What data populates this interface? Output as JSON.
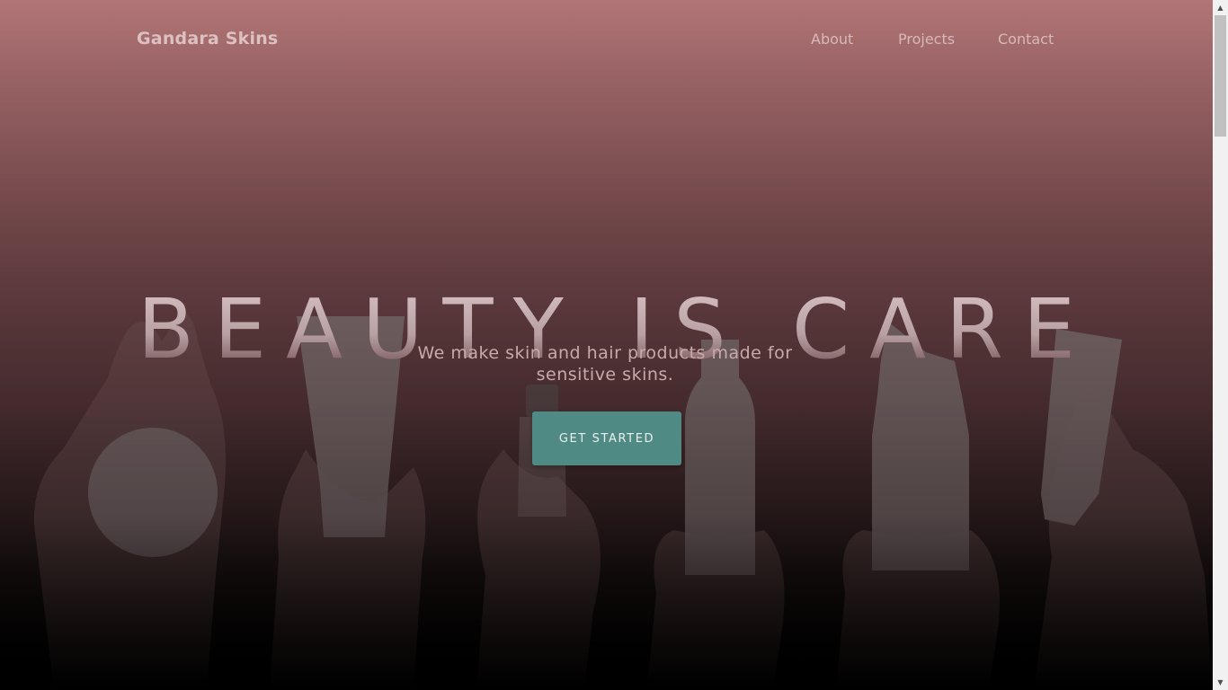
{
  "brand": {
    "name": "Gandara Skins"
  },
  "nav": {
    "items": [
      {
        "label": "About"
      },
      {
        "label": "Projects"
      },
      {
        "label": "Contact"
      }
    ]
  },
  "hero": {
    "headline": "BEAUTY IS CARE",
    "subtitle": "We make skin and hair products made for sensitive skins.",
    "cta_label": "GET STARTED"
  },
  "colors": {
    "accent": "#4f8a85",
    "background_top": "#b27577",
    "background_bottom": "#000000"
  },
  "image_content": {
    "description_icons": [
      "cotton-pad",
      "cream-tube",
      "dropper-bottle",
      "foam-pump-bottle",
      "airless-pump-bottle",
      "small-tube"
    ]
  }
}
